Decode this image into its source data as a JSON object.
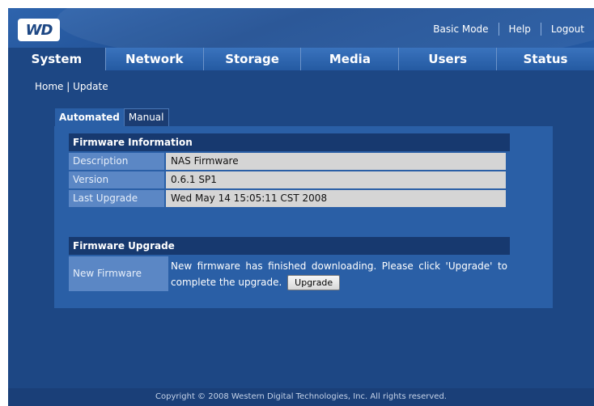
{
  "header": {
    "logo_text": "WD",
    "links": {
      "basic_mode": "Basic Mode",
      "help": "Help",
      "logout": "Logout"
    }
  },
  "nav": {
    "tabs": [
      {
        "label": "System",
        "active": true
      },
      {
        "label": "Network",
        "active": false
      },
      {
        "label": "Storage",
        "active": false
      },
      {
        "label": "Media",
        "active": false
      },
      {
        "label": "Users",
        "active": false
      },
      {
        "label": "Status",
        "active": false
      }
    ]
  },
  "breadcrumb": {
    "home": "Home",
    "separator": "|",
    "current": "Update"
  },
  "subtabs": {
    "automated": "Automated",
    "manual": "Manual"
  },
  "firmware_info": {
    "title": "Firmware Information",
    "rows": [
      {
        "label": "Description",
        "value": "NAS Firmware"
      },
      {
        "label": "Version",
        "value": "0.6.1 SP1"
      },
      {
        "label": "Last Upgrade",
        "value": "Wed May 14 15:05:11 CST 2008"
      }
    ]
  },
  "firmware_upgrade": {
    "title": "Firmware Upgrade",
    "label": "New Firmware",
    "message_line1": "New firmware has finished downloading. Please click 'Upgrade' to",
    "message_line2": "complete the upgrade.",
    "button_label": "Upgrade"
  },
  "footer": {
    "copyright": "Copyright © 2008 Western Digital Technologies, Inc. All rights reserved."
  },
  "colors": {
    "background": "#1d4784",
    "accent": "#2a63ad",
    "section_header": "#17396f"
  }
}
